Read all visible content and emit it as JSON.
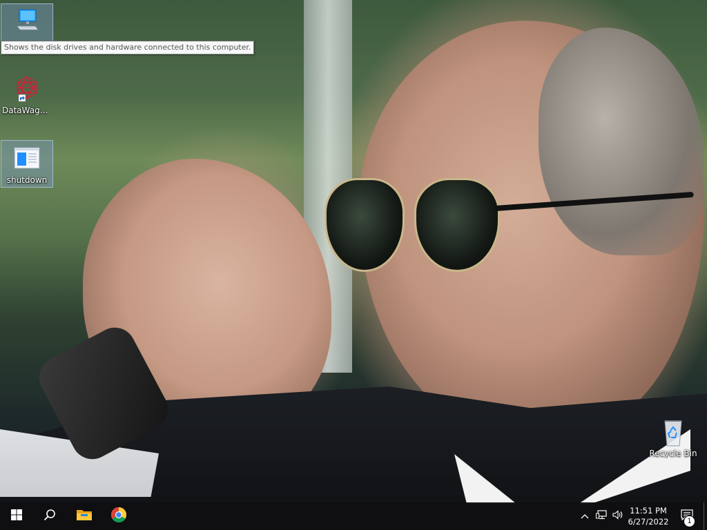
{
  "desktop": {
    "icons": [
      {
        "label": "",
        "icon": "this-pc-icon"
      },
      {
        "label": "DataWagon...",
        "icon": "datawagon-icon"
      },
      {
        "label": "shutdown",
        "icon": "shutdown-file-icon"
      },
      {
        "label": "Recycle Bin",
        "icon": "recycle-bin-icon"
      }
    ],
    "tooltip": "Shows the disk drives and hardware connected to this computer."
  },
  "taskbar": {
    "buttons": [
      {
        "icon": "windows-start-icon"
      },
      {
        "icon": "search-icon"
      },
      {
        "icon": "file-explorer-icon"
      },
      {
        "icon": "chrome-icon"
      }
    ],
    "tray": {
      "icons": [
        "chevron-up-icon",
        "network-icon",
        "volume-icon"
      ],
      "time": "11:51 PM",
      "date": "6/27/2022",
      "notification_count": "1"
    }
  },
  "colors": {
    "taskbar_bg": "#101012",
    "selection": "#7896be",
    "windows_blue": "#1f8fff"
  }
}
